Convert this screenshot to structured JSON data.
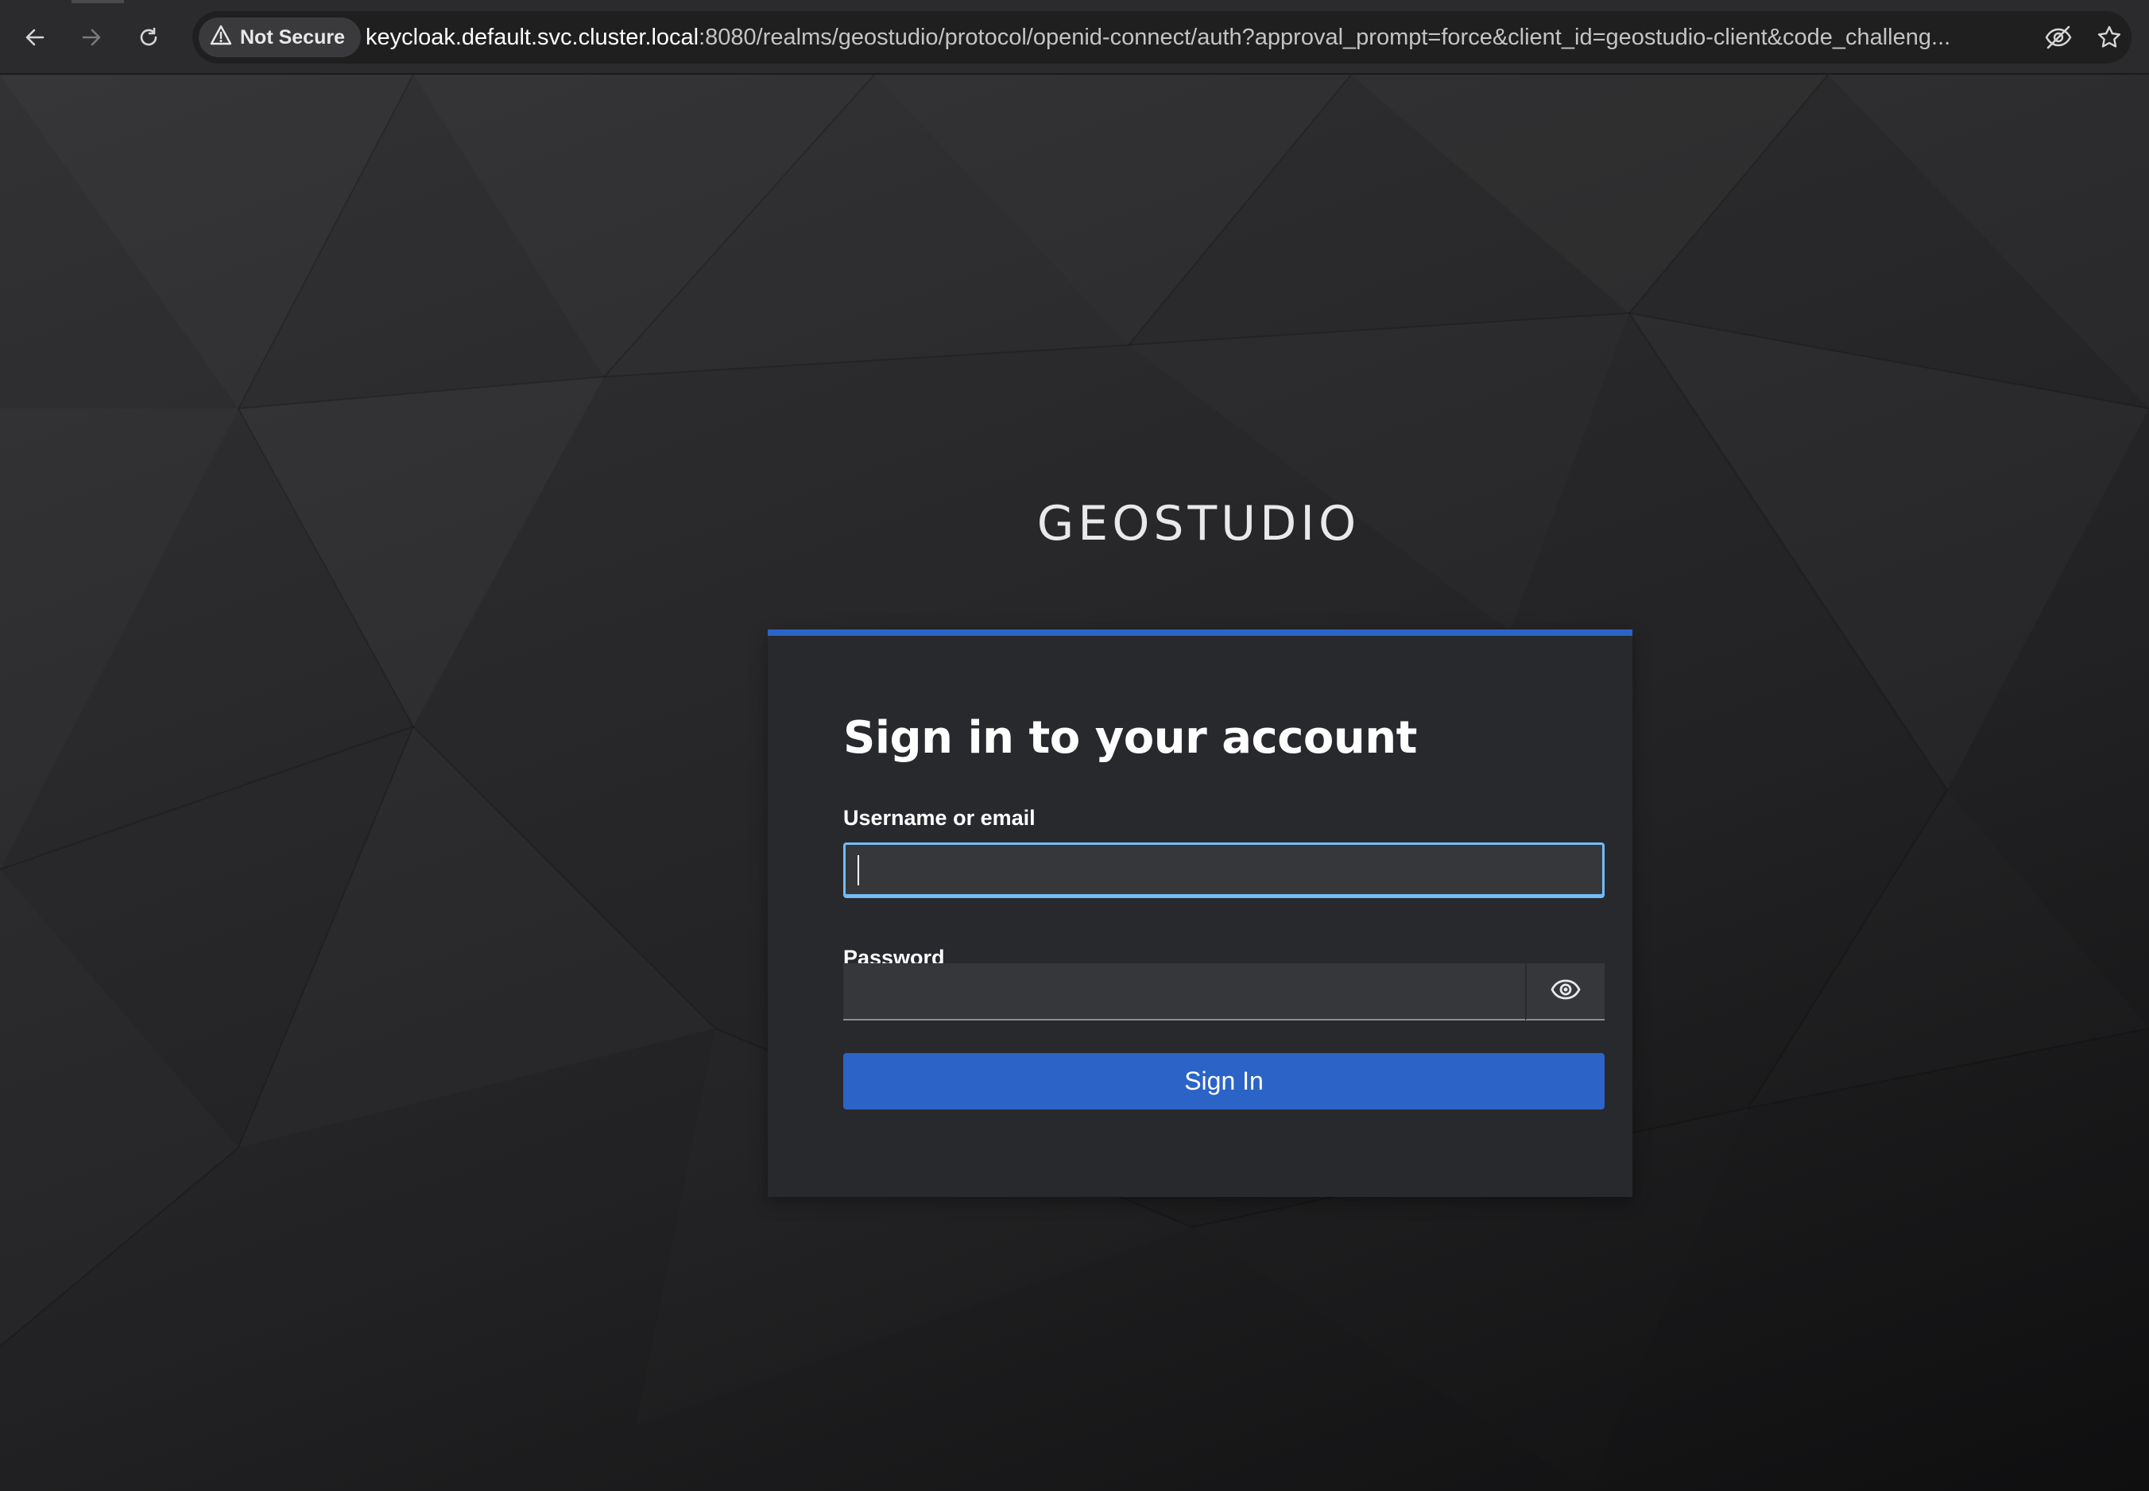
{
  "browser": {
    "security_label": "Not Secure",
    "url_host": "keycloak.default.svc.cluster.local",
    "url_rest": ":8080/realms/geostudio/protocol/openid-connect/auth?approval_prompt=force&client_id=geostudio-client&code_challeng...",
    "icons": [
      "back-arrow-icon",
      "forward-arrow-icon",
      "reload-icon",
      "warning-icon",
      "eye-slash-icon",
      "star-icon"
    ]
  },
  "page": {
    "brand": "GEOSTUDIO",
    "login": {
      "title": "Sign in to your account",
      "username_label": "Username or email",
      "username_value": "",
      "password_label": "Password",
      "password_value": "",
      "submit_label": "Sign In"
    }
  },
  "colors": {
    "accent": "#2b64c6",
    "focus": "#73bcf7",
    "card_bg": "#27292d",
    "input_bg": "#36373b"
  }
}
